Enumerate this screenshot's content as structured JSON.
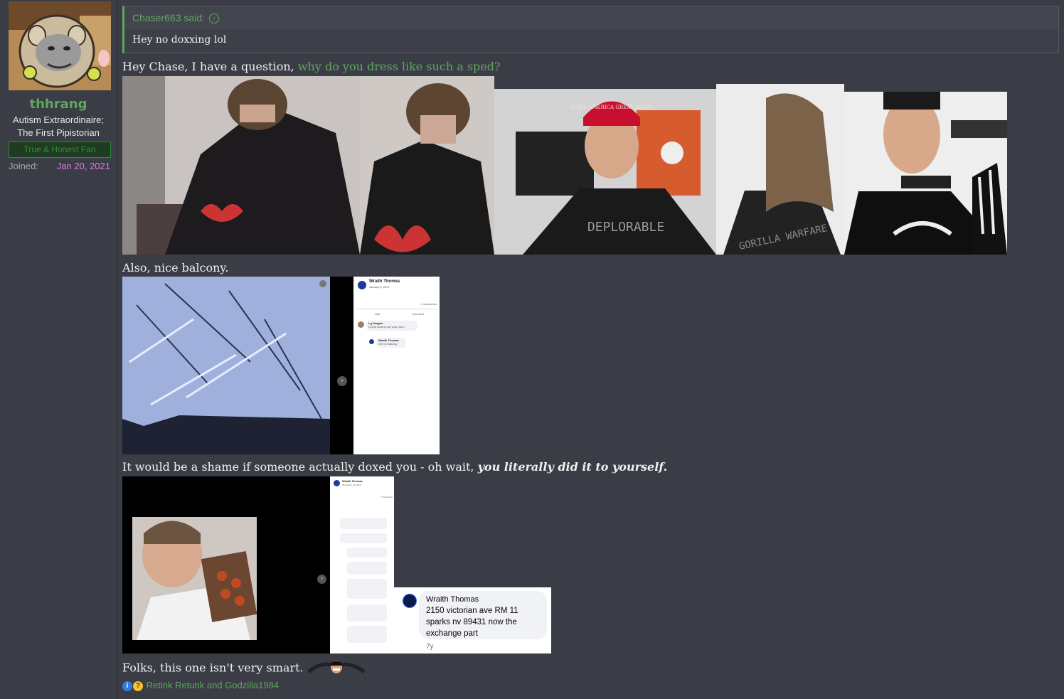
{
  "user": {
    "name": "thhrang",
    "title_line1": "Autism Extraordinaire;",
    "title_line2": "The First Pipistorian",
    "banner": "True & Honest Fan",
    "joined_label": "Joined:",
    "joined_value": "Jan 20, 2021"
  },
  "quote": {
    "author": "Chaser663 said:",
    "arrow_icon": "up-arrow-icon",
    "text": "Hey no doxxing lol"
  },
  "post": {
    "line1_plain": "Hey Chase, I have a question,",
    "line1_link": "why do you dress like such a sped?",
    "line2": "Also, nice balcony.",
    "line3_plain": "It would be a shame if someone actually doxed you - oh wait,",
    "line3_emph": "you literally did it to yourself.",
    "line4": "Folks, this one isn't very smart."
  },
  "fb1": {
    "name": "Wraith Thomas",
    "date": "January 5, 2017",
    "comments": "2 comments",
    "like": "Like",
    "comment": "Comment",
    "c1_name": "Lg Vaughn",
    "c1_text": "Is that looking out your door?",
    "c2_name": "Wraith Thomas",
    "c2_text": "Off my balcony"
  },
  "fb2": {
    "name": "Wraith Thomas",
    "date": "November 14, 2019",
    "comments": "7 comments",
    "popup_name": "Wraith Thomas",
    "popup_line1": "2150 victorian ave RM 11",
    "popup_line2": "sparks nv 89431 now the",
    "popup_line3": "exchange part",
    "popup_time": "7y"
  },
  "photo_texts": {
    "hat": "MAKE AMERICA GREAT AGAIN",
    "shirt1": "DEPLORABLE",
    "shirt2": "GORILLA WARFARE"
  },
  "reactions": {
    "text": "Retink Retunk and Godzilla1984",
    "icons": [
      "informative-icon",
      "thinking-icon"
    ]
  },
  "colors": {
    "accent": "#5ea85e",
    "joined": "#e07be0",
    "background": "#3a3d45"
  }
}
